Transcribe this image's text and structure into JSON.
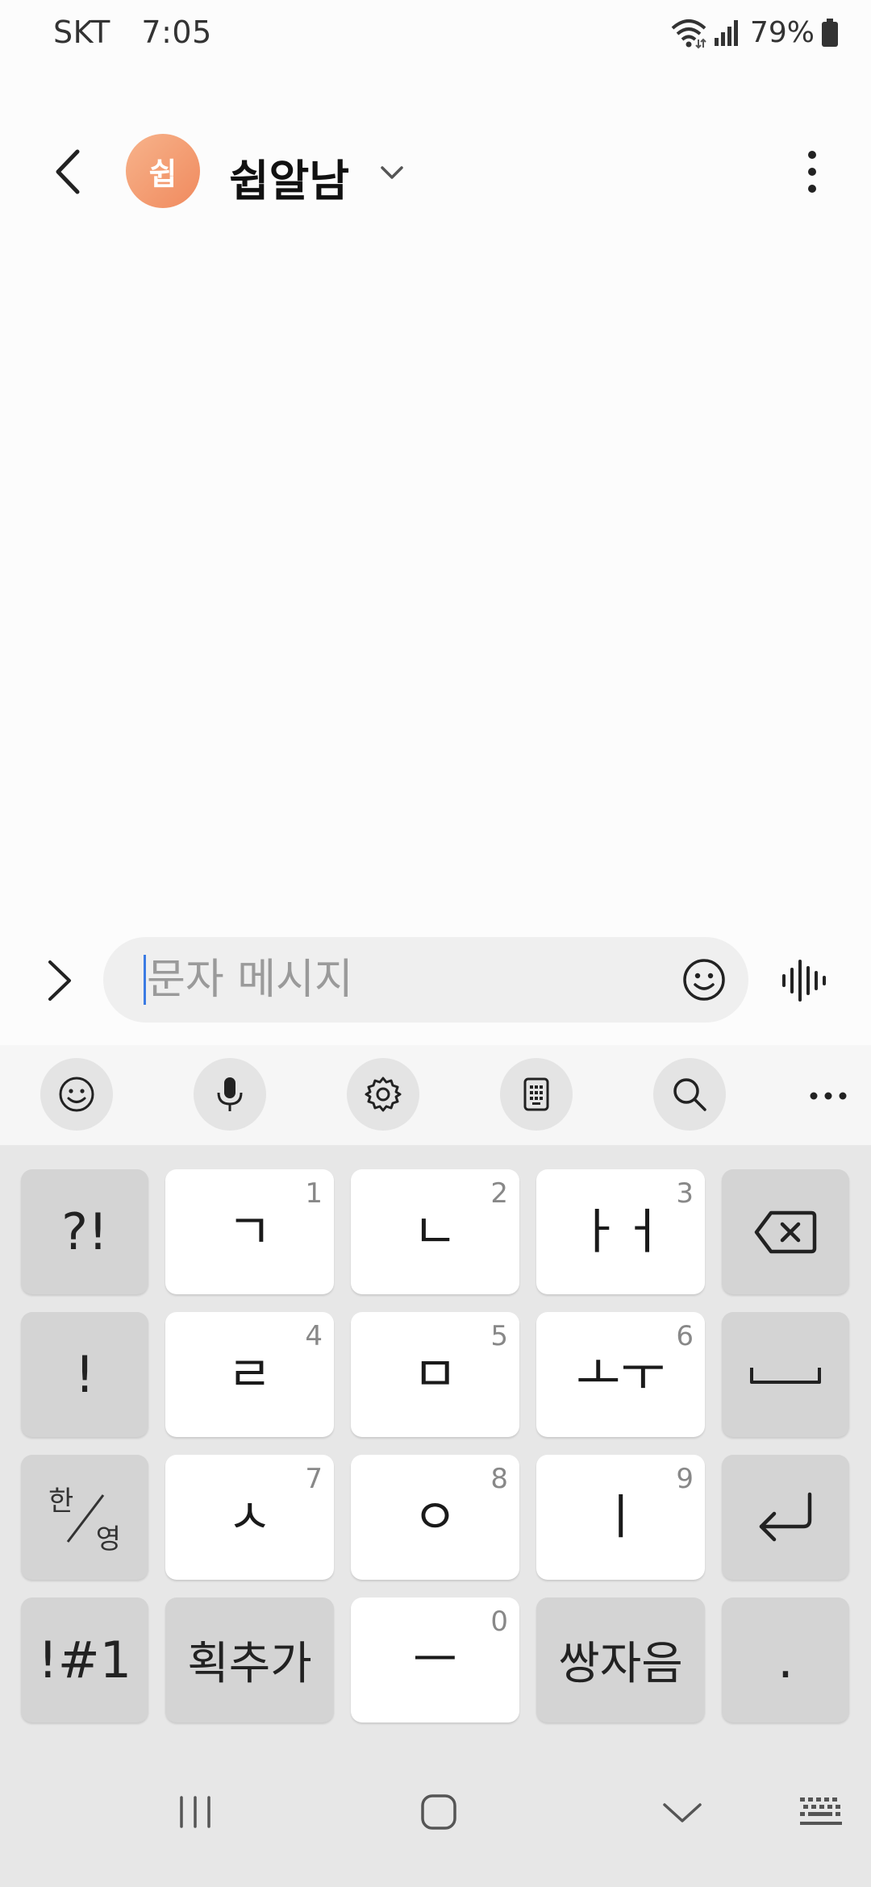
{
  "status_bar": {
    "carrier": "SKT",
    "time": "7:05",
    "battery": "79%",
    "icons": [
      "wifi-icon",
      "signal-icon",
      "battery-icon"
    ]
  },
  "header": {
    "avatar_initial": "쉽",
    "contact_name": "쉽알남",
    "avatar_color": "#f29a6e",
    "icons": [
      "back-arrow-icon",
      "chevron-down-icon",
      "more-vertical-icon"
    ]
  },
  "composer": {
    "placeholder": "문자 메시지",
    "icons": [
      "chevron-right-icon",
      "emoji-icon",
      "voice-waveform-icon"
    ],
    "cursor_color": "#3b7be3"
  },
  "keyboard_toolbar": {
    "icons": [
      "emoji-icon",
      "microphone-icon",
      "settings-gear-icon",
      "clipboard-icon",
      "search-icon",
      "more-horizontal-icon"
    ]
  },
  "keyboard": {
    "rows": [
      [
        {
          "label": "?!",
          "num": ""
        },
        {
          "label": "ㄱ",
          "num": "1"
        },
        {
          "label": "ㄴ",
          "num": "2"
        },
        {
          "label": "ㅏㅓ",
          "num": "3"
        },
        {
          "label": "",
          "icon": "backspace-icon"
        }
      ],
      [
        {
          "label": "!",
          "num": ""
        },
        {
          "label": "ㄹ",
          "num": "4"
        },
        {
          "label": "ㅁ",
          "num": "5"
        },
        {
          "label": "ㅗㅜ",
          "num": "6"
        },
        {
          "label": "",
          "icon": "space-icon"
        }
      ],
      [
        {
          "label_top": "한",
          "label_bottom": "영"
        },
        {
          "label": "ㅅ",
          "num": "7"
        },
        {
          "label": "ㅇ",
          "num": "8"
        },
        {
          "label": "ㅣ",
          "num": "9"
        },
        {
          "label": "",
          "icon": "enter-icon"
        }
      ],
      [
        {
          "label": "!#1",
          "num": ""
        },
        {
          "label": "획추가",
          "num": ""
        },
        {
          "label": "ㅡ",
          "num": "0"
        },
        {
          "label": "쌍자음",
          "num": ""
        },
        {
          "label": ".",
          "num": ""
        }
      ]
    ]
  },
  "nav_bar": {
    "icons": [
      "recent-apps-icon",
      "home-icon",
      "back-chevron-icon",
      "keyboard-icon"
    ]
  }
}
